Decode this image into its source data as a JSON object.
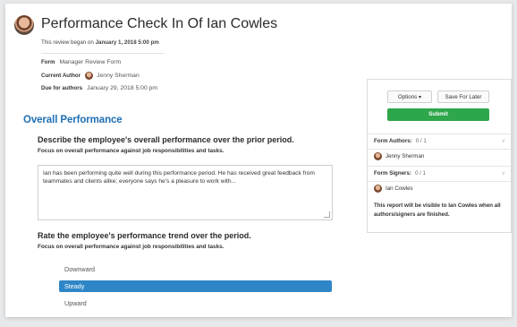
{
  "header": {
    "title": "Performance Check In Of Ian Cowles",
    "began_prefix": "This review began on",
    "began_date": "January 1, 2018 5:00 pm"
  },
  "meta": {
    "form_label": "Form",
    "form_value": "Manager Review Form",
    "author_label": "Current Author",
    "author_value": "Jenny Sherman",
    "due_label": "Due for authors",
    "due_value": "January 29, 2018 5:00 pm"
  },
  "section": {
    "title": "Overall Performance"
  },
  "q1": {
    "title": "Describe the employee's overall performance over the prior period.",
    "subtitle": "Focus on overall performance against job responsibilities and tasks.",
    "answer": "Ian has been performing quite well during this performance period. He has received great feedback from teammates and clients alike; everyone says he's a pleasure to work with..."
  },
  "q2": {
    "title": "Rate the employee's performance trend over the period.",
    "subtitle": "Focus on overall performance against job responsibilities and tasks.",
    "options": [
      "Downward",
      "Steady",
      "Upward"
    ],
    "selected": "Steady"
  },
  "panel": {
    "options_label": "Options",
    "save_label": "Save For Later",
    "submit_label": "Submit",
    "authors_label": "Form Authors:",
    "authors_count": "0 / 1",
    "author_name": "Jenny Sherman",
    "signers_label": "Form Signers:",
    "signers_count": "0 / 1",
    "signer_name": "Ian Cowles",
    "note": "This report will be visible to Ian Cowles when all authors/signers are finished."
  },
  "colors": {
    "accent": "#1f6fb5",
    "selected": "#2f86c7",
    "submit": "#2ea64b"
  }
}
